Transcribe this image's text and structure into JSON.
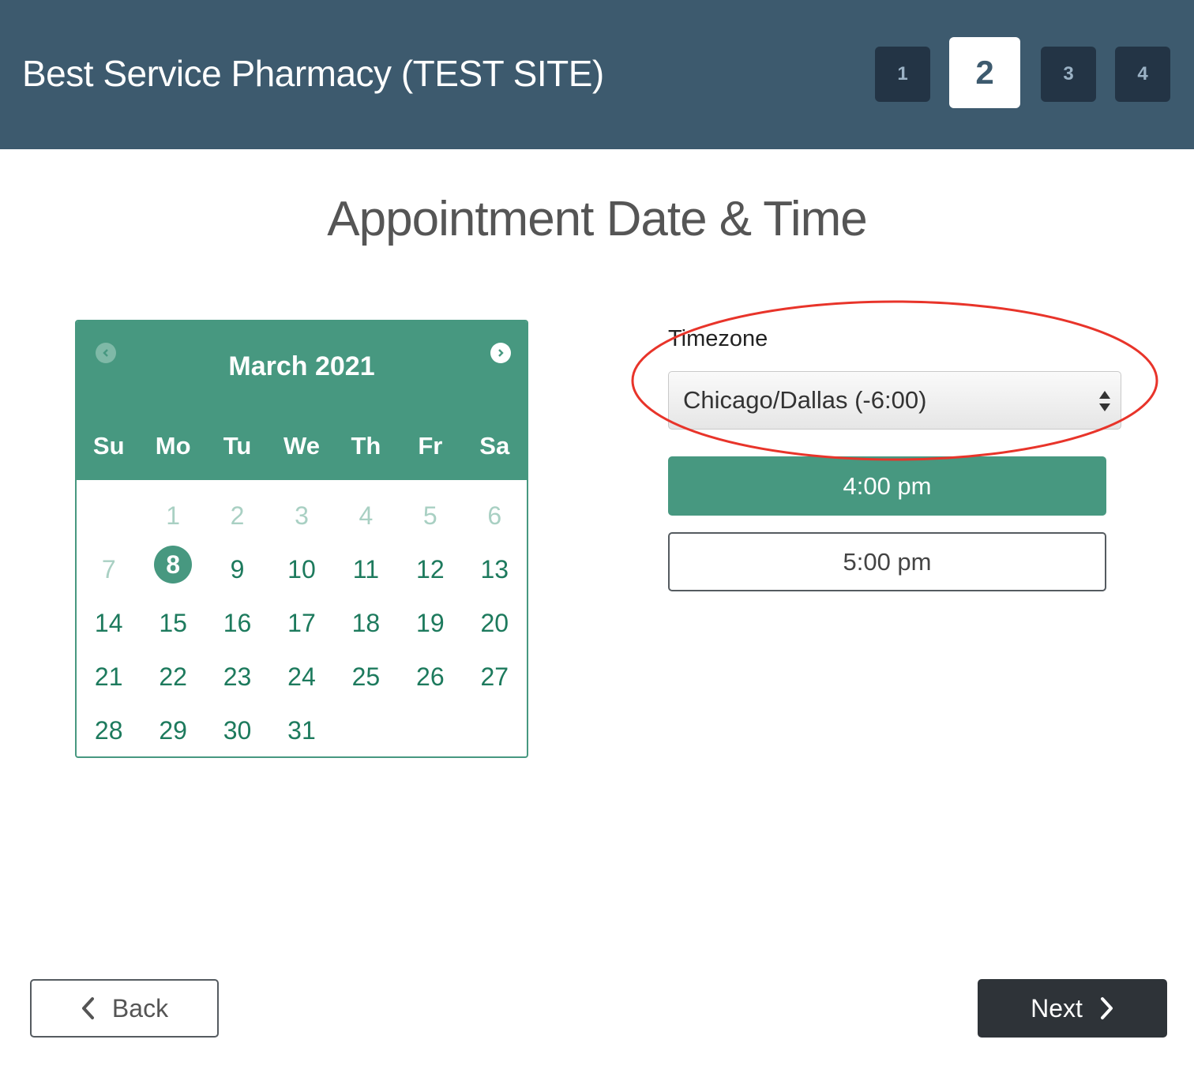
{
  "header": {
    "site_title": "Best Service Pharmacy (TEST SITE)",
    "steps": [
      "1",
      "2",
      "3",
      "4"
    ],
    "active_step": "2"
  },
  "page_title": "Appointment Date & Time",
  "calendar": {
    "month_label": "March 2021",
    "weekdays": [
      "Su",
      "Mo",
      "Tu",
      "We",
      "Th",
      "Fr",
      "Sa"
    ],
    "weeks": [
      [
        "",
        "1",
        "2",
        "3",
        "4",
        "5",
        "6"
      ],
      [
        "7",
        "8",
        "9",
        "10",
        "11",
        "12",
        "13"
      ],
      [
        "14",
        "15",
        "16",
        "17",
        "18",
        "19",
        "20"
      ],
      [
        "21",
        "22",
        "23",
        "24",
        "25",
        "26",
        "27"
      ],
      [
        "28",
        "29",
        "30",
        "31",
        "",
        "",
        ""
      ]
    ],
    "unavailable_days": [
      "1",
      "2",
      "3",
      "4",
      "5",
      "6",
      "7"
    ],
    "selected_day": "8",
    "prev_icon": "chevron-left-circle-icon",
    "next_icon": "chevron-right-circle-icon"
  },
  "timezone": {
    "label": "Timezone",
    "value": "Chicago/Dallas (-6:00)"
  },
  "times": [
    {
      "label": "4:00 pm",
      "selected": true
    },
    {
      "label": "5:00 pm",
      "selected": false
    }
  ],
  "footer": {
    "back_label": "Back",
    "next_label": "Next"
  },
  "colors": {
    "header_bg": "#3d5a6e",
    "accent_green": "#479880",
    "next_button_bg": "#2e3338",
    "annotation_red": "#e8342a"
  }
}
